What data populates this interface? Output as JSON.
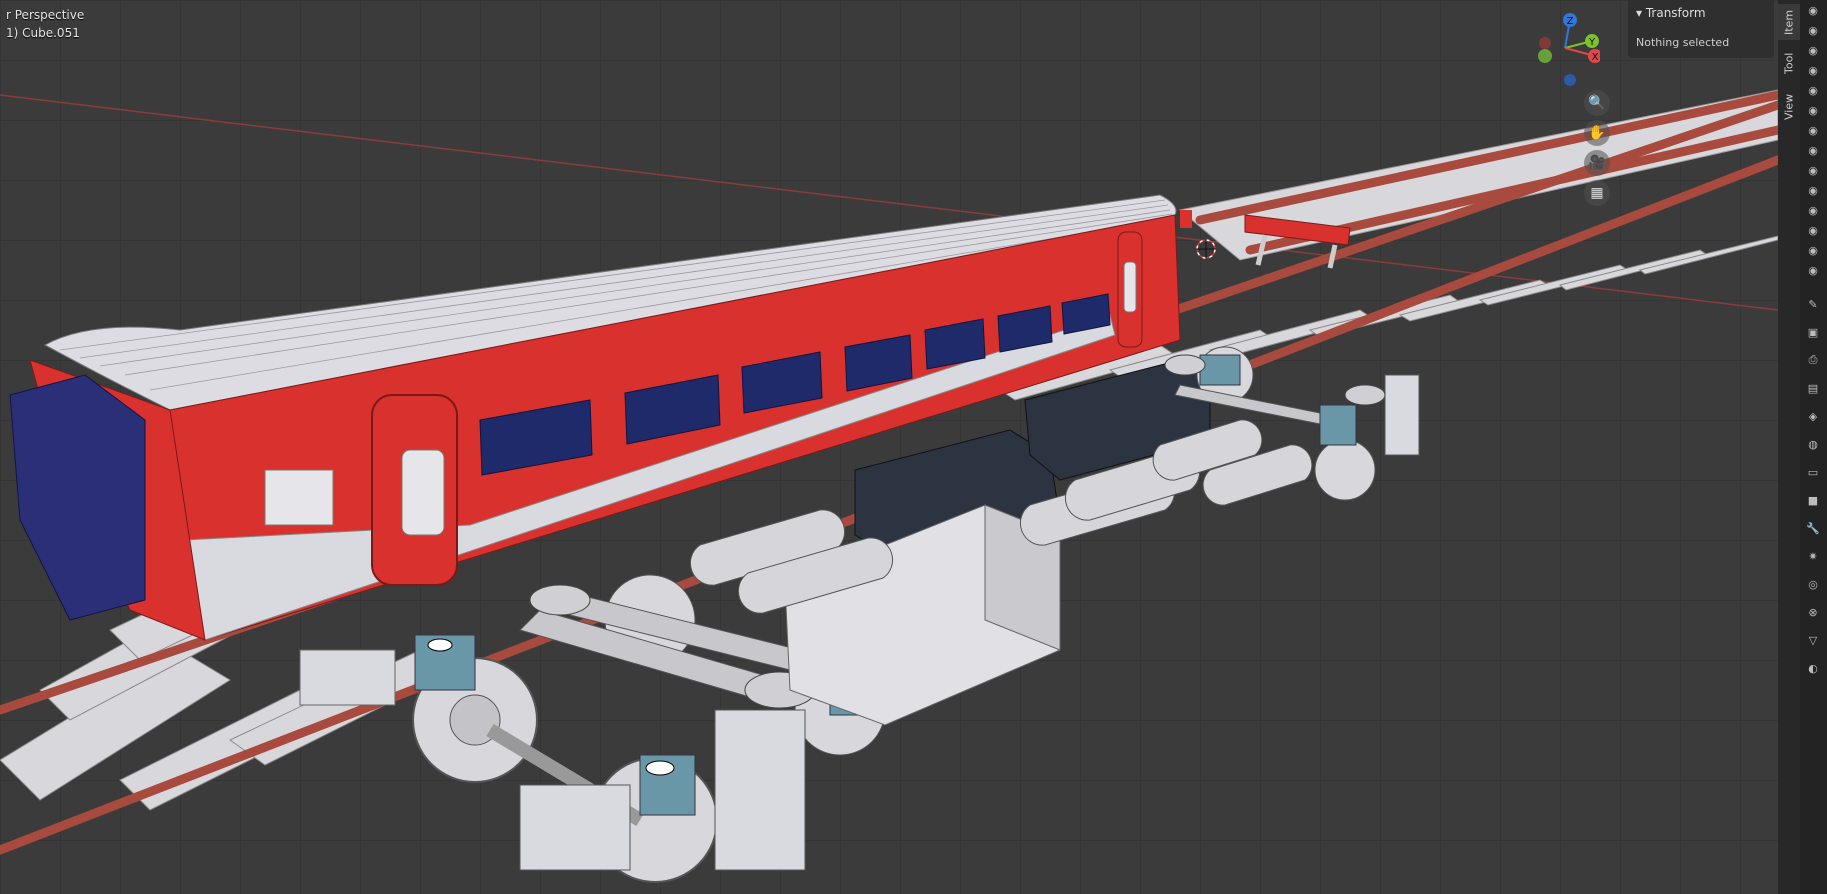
{
  "viewport": {
    "mode_label": "r Perspective",
    "object_label": "1) Cube.051"
  },
  "gizmo": {
    "axes": [
      {
        "label": "Z",
        "color": "#2f77d9"
      },
      {
        "label": "Y",
        "color": "#7bc22e"
      },
      {
        "label": "X",
        "color": "#e04848"
      }
    ]
  },
  "nav_buttons": [
    {
      "icon": "zoom-icon",
      "glyph": "🔍"
    },
    {
      "icon": "hand-icon",
      "glyph": "✋"
    },
    {
      "icon": "camera-icon",
      "glyph": "🎥"
    },
    {
      "icon": "grid-icon",
      "glyph": "▦"
    }
  ],
  "n_panel": {
    "section_title": "Transform",
    "content": "Nothing selected"
  },
  "side_tabs": [
    {
      "label": "Item",
      "active": true
    },
    {
      "label": "Tool",
      "active": false
    },
    {
      "label": "View",
      "active": false
    }
  ],
  "properties_icons": [
    "camera-icon",
    "camera-icon",
    "camera-icon",
    "camera-icon",
    "camera-icon",
    "camera-icon",
    "camera-icon",
    "camera-icon",
    "camera-icon",
    "camera-icon",
    "camera-icon",
    "camera-icon",
    "camera-icon",
    "camera-icon",
    "tool-icon",
    "render-icon",
    "output-icon",
    "view-layer-icon",
    "scene-icon",
    "world-icon",
    "collection-icon",
    "object-icon",
    "modifier-icon",
    "particles-icon",
    "physics-icon",
    "constraint-icon",
    "data-icon",
    "material-icon"
  ],
  "colors": {
    "train_red": "#d8312e",
    "train_white": "#d9dadf",
    "window_blue": "#1f2a6b",
    "rail_red": "#a84a3e",
    "sleeper": "#d7d7db"
  }
}
